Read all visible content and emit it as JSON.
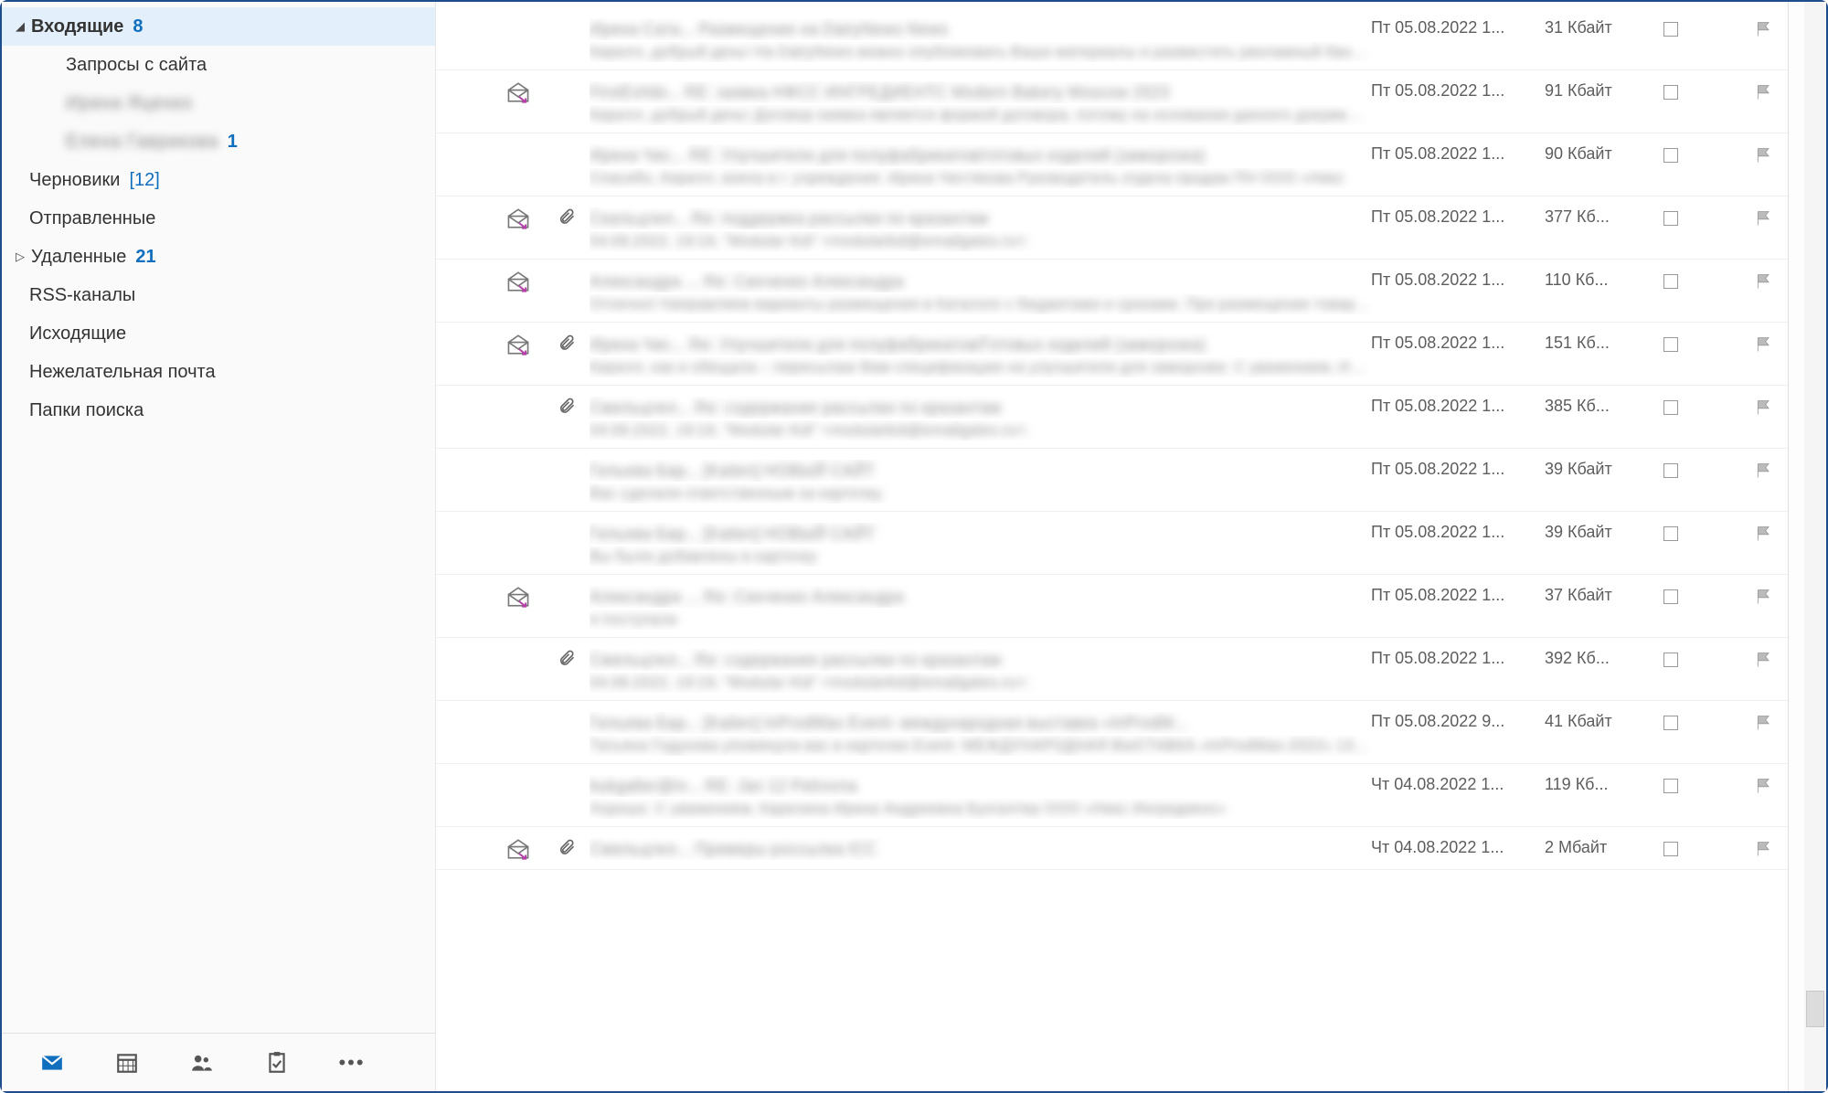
{
  "sidebar": {
    "folders": [
      {
        "label": "Входящие",
        "count": "8",
        "countStyle": "blue",
        "expanded": true,
        "selected": true,
        "bold": true
      },
      {
        "label": "Запросы с сайта",
        "count": "",
        "sub": true
      },
      {
        "label": "Ирина Яценко",
        "count": "",
        "sub": true,
        "faded": true
      },
      {
        "label": "Елена Гаврикова",
        "count": "1",
        "countStyle": "blue",
        "sub": true,
        "faded": true
      },
      {
        "label": "Черновики",
        "count": "[12]",
        "countStyle": "bracket"
      },
      {
        "label": "Отправленные",
        "count": ""
      },
      {
        "label": "Удаленные",
        "count": "21",
        "countStyle": "blue",
        "collapsed": true
      },
      {
        "label": "RSS-каналы",
        "count": ""
      },
      {
        "label": "Исходящие",
        "count": ""
      },
      {
        "label": "Нежелательная почта",
        "count": ""
      },
      {
        "label": "Папки поиска",
        "count": ""
      }
    ]
  },
  "messages": [
    {
      "icon": "",
      "attach": false,
      "sender": "Ирина Сата...",
      "subject": "Размещение на DairyNews News",
      "preview": "Кирилл, добрый день! На DairyNews можно опубликовать Ваши материалы и разместить рекламный баннер.",
      "date": "Пт 05.08.2022 1...",
      "size": "31 Кбайт"
    },
    {
      "icon": "replied",
      "attach": false,
      "sender": "FirstExhibi...",
      "subject": "RE: заявка НФСС ИНГРЕДИЕНТС Modern Bakery Moscow 2023",
      "preview": "Кирилл, добрый день!  Договор-заявка является формой договора, потому на основании данного документа мы",
      "date": "Пт 05.08.2022 1...",
      "size": "91 Кбайт"
    },
    {
      "icon": "",
      "attach": false,
      "sender": "Ирина Чис...",
      "subject": "RE: Улучшители для полуфабрикатов/готовых изделий (заморозка)",
      "preview": "Спасибо, Кирилл, взяла в  г. учреждения.  Ирина Чистякова  Руководитель отдела продаж ПН  ООО «Никс",
      "date": "Пт 05.08.2022 1...",
      "size": "90 Кбайт"
    },
    {
      "icon": "replied",
      "attach": true,
      "sender": "Скальцгюл...",
      "subject": "Re: поддержка рассылки по крaзантам",
      "preview": "04.08.2022, 19:19, \"Modular Kid\" <modularkid@emailgates.ru>:",
      "date": "Пт 05.08.2022 1...",
      "size": "377 Кб..."
    },
    {
      "icon": "replied",
      "attach": false,
      "sender": "Александра ...",
      "subject": "Re: Синченко Александра",
      "preview": "Отлично! Направляем варианты размещения в Каталоге с бюджетами и сроками.   При  размещении товаров и",
      "date": "Пт 05.08.2022 1...",
      "size": "110 Кб..."
    },
    {
      "icon": "replied",
      "attach": true,
      "sender": "Ирина Чис...",
      "subject": "Re: Улучшители для полуфабрикатов/Готовых изделий (заморозка)",
      "preview": "Кирилл, как и обещала – пересылаю Вам спецификацию на улучшители для заморозки.  С уважением,  Ирина",
      "date": "Пт 05.08.2022 1...",
      "size": "151 Кб..."
    },
    {
      "icon": "",
      "attach": true,
      "sender": "Смельцгюл...",
      "subject": "Re: содержание рассылки по крaзантам",
      "preview": "04.08.2022, 19:19, \"Modular Kid\" <modularkid@emailgates.ru>:",
      "date": "Пт 05.08.2022 1...",
      "size": "385 Кб..."
    },
    {
      "icon": "",
      "attach": false,
      "sender": "Гильева Бар...",
      "subject": "[Kaiten] НОВЫЙ САЙТ",
      "preview": "Вас сделали ответственным за карточку.",
      "date": "Пт 05.08.2022 1...",
      "size": "39 Кбайт"
    },
    {
      "icon": "",
      "attach": false,
      "sender": "Гильева Бар...",
      "subject": "[Kaiten] НОВЫЙ САЙТ",
      "preview": "Вы были добавлены в карточку",
      "date": "Пт 05.08.2022 1...",
      "size": "39 Кбайт"
    },
    {
      "icon": "replied",
      "attach": false,
      "sender": "Александра ...",
      "subject": "Re: Синченко Александра",
      "preview": "я поступала",
      "date": "Пт 05.08.2022 1...",
      "size": "37 Кбайт"
    },
    {
      "icon": "",
      "attach": true,
      "sender": "Смельцгюл...",
      "subject": "Re: содержание рассылки по крaзантам",
      "preview": "04.08.2022, 19:19, \"Modular Kid\" <modularkid@emailgates.ru>:",
      "date": "Пт 05.08.2022 1...",
      "size": "392 Кб..."
    },
    {
      "icon": "",
      "attach": false,
      "sender": "Гильева Бар...",
      "subject": "[Kaiten] InProdMax Event- международная выставка «InProdM...",
      "preview": "Татьяна Годунова упомянула вас в карточке Event- МЕЖДУНАРОДНАЯ ВЫСТАВКА «InProdMax-2022» 13-16-09",
      "date": "Пт 05.08.2022 9...",
      "size": "41 Кбайт"
    },
    {
      "icon": "",
      "attach": false,
      "sender": "bukgalter@in...",
      "subject": "RE: Jan 12 Petrovna",
      "preview": "Хорошо.  С уважением,  Карелина Ирина Андреевна  Бухгалтер  ООО «Никс Ингредиенс»",
      "date": "Чт 04.08.2022 1...",
      "size": "119 Кб..."
    },
    {
      "icon": "replied",
      "attach": true,
      "sender": "Смельцгюл...",
      "subject": "Примеры россылка ICC",
      "preview": "",
      "date": "Чт 04.08.2022 1...",
      "size": "2 Мбайт"
    }
  ]
}
